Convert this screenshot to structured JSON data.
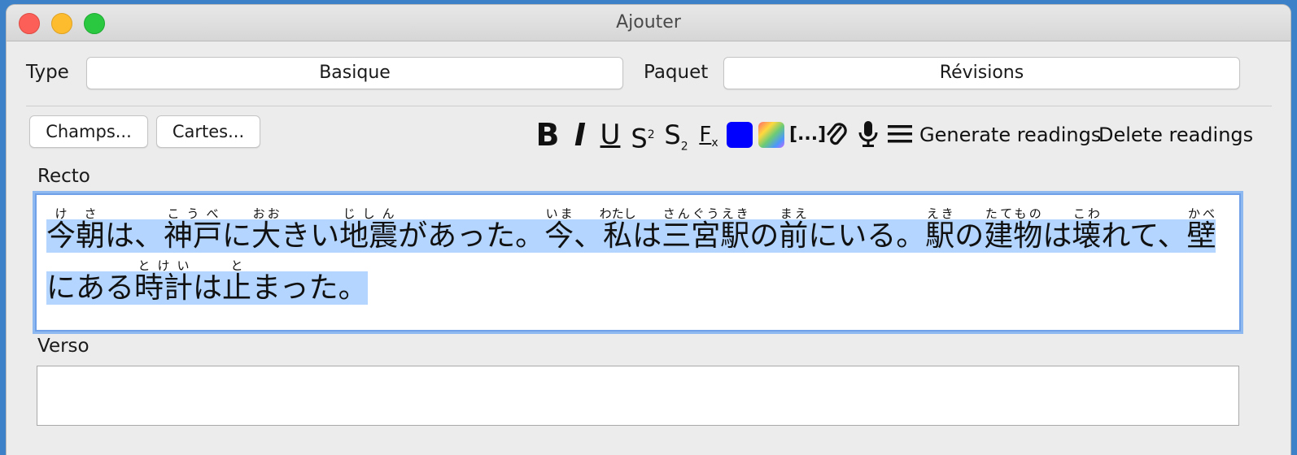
{
  "window": {
    "title": "Ajouter"
  },
  "controls": {
    "type_label": "Type",
    "type_value": "Basique",
    "deck_label": "Paquet",
    "deck_value": "Révisions"
  },
  "buttons": {
    "fields": "Champs...",
    "cards": "Cartes..."
  },
  "toolbar": {
    "bold": "B",
    "italic": "I",
    "underline": "U",
    "superscript": "S",
    "subscript": "S",
    "clear_format": "F",
    "cloze": "[...]",
    "generate": "Generate readings",
    "delete": "Delete readings",
    "text_color": "#0000ff"
  },
  "fields": {
    "front_label": "Recto",
    "back_label": "Verso",
    "back_value": "",
    "front_segments": [
      {
        "base": "今朝",
        "ruby": "けさ"
      },
      {
        "text": "は、"
      },
      {
        "base": "神戸",
        "ruby": "こうべ"
      },
      {
        "text": "に"
      },
      {
        "base": "大",
        "ruby": "おお"
      },
      {
        "text": "きい"
      },
      {
        "base": "地震",
        "ruby": "じしん"
      },
      {
        "text": "があった。"
      },
      {
        "base": "今",
        "ruby": "いま"
      },
      {
        "text": "、"
      },
      {
        "base": "私",
        "ruby": "わたし"
      },
      {
        "text": "は"
      },
      {
        "base": "三宮",
        "ruby": "さんぐう"
      },
      {
        "base": "駅",
        "ruby": "えき"
      },
      {
        "text": "の"
      },
      {
        "base": "前",
        "ruby": "まえ"
      },
      {
        "text": "にいる。"
      },
      {
        "base": "駅",
        "ruby": "えき"
      },
      {
        "text": "の"
      },
      {
        "base": "建物",
        "ruby": "たてもの"
      },
      {
        "text": "は"
      },
      {
        "base": "壊",
        "ruby": "こわ"
      },
      {
        "text": "れて、"
      },
      {
        "base": "壁",
        "ruby": "かべ"
      },
      {
        "text": "にある"
      },
      {
        "base": "時計",
        "ruby": "とけい"
      },
      {
        "text": "は"
      },
      {
        "base": "止",
        "ruby": "と"
      },
      {
        "text": "まった。"
      }
    ]
  }
}
